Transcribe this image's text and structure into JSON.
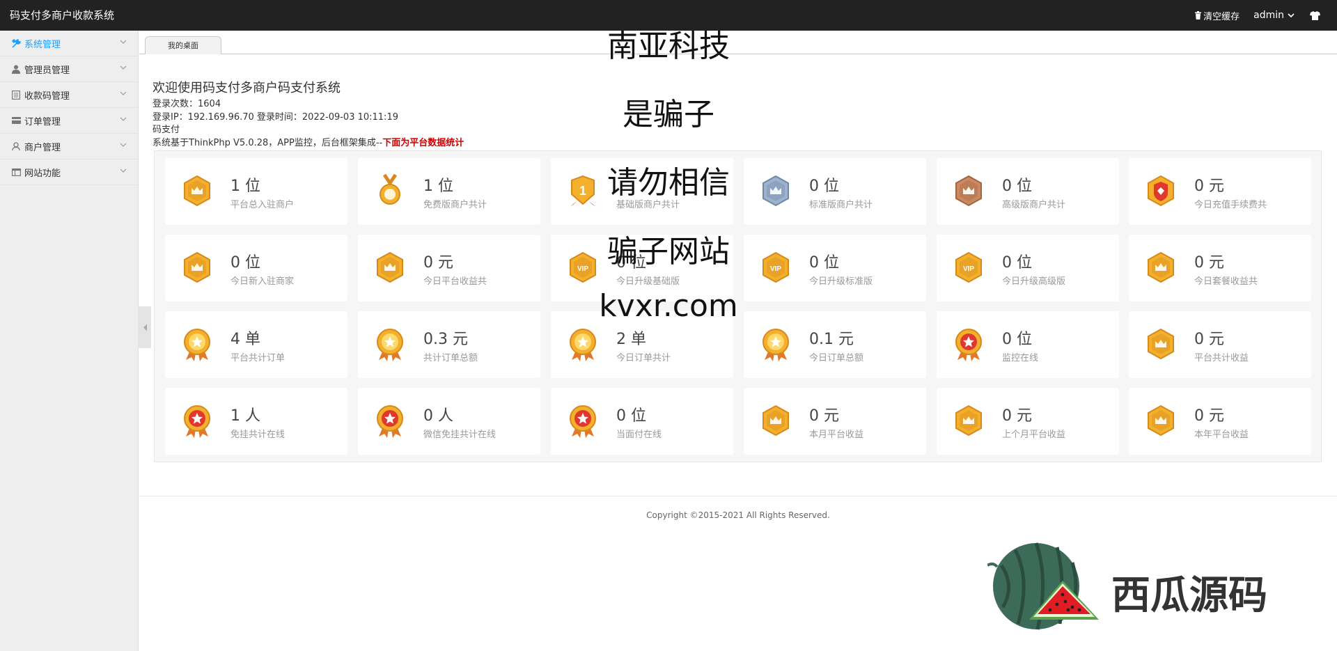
{
  "header": {
    "app_title": "码支付多商户收款系统",
    "clear_cache_label": "清空缓存",
    "user_label": "admin"
  },
  "sidebar": {
    "items": [
      {
        "label": "系统管理",
        "icon": "tools-icon"
      },
      {
        "label": "管理员管理",
        "icon": "user-icon"
      },
      {
        "label": "收款码管理",
        "icon": "document-icon"
      },
      {
        "label": "订单管理",
        "icon": "card-icon"
      },
      {
        "label": "商户管理",
        "icon": "merchant-icon"
      },
      {
        "label": "网站功能",
        "icon": "window-icon"
      }
    ]
  },
  "tabs": [
    {
      "label": "我的桌面"
    }
  ],
  "welcome": {
    "title": "欢迎使用码支付多商户码支付系统",
    "login_count": "登录次数：1604",
    "login_ip": "登录IP：192.169.96.70 登录时间：2022-09-03 10:11:19",
    "product": "码支付",
    "desc_prefix": "系统基于ThinkPhp V5.0.28，APP监控，后台框架集成--",
    "desc_highlight": "下面为平台数据统计"
  },
  "stats": [
    {
      "value": "1 位",
      "label": "平台总入驻商户",
      "medal": "crown-gold"
    },
    {
      "value": "1 位",
      "label": "免费版商户共计",
      "medal": "ribbon-gold"
    },
    {
      "value": "",
      "label": "基础版商户共计",
      "medal": "number-one"
    },
    {
      "value": "0 位",
      "label": "标准版商户共计",
      "medal": "crown-silver"
    },
    {
      "value": "0 位",
      "label": "高级版商户共计",
      "medal": "crown-bronze"
    },
    {
      "value": "0 元",
      "label": "今日充值手续费共",
      "medal": "red-shield"
    },
    {
      "value": "0 位",
      "label": "今日新入驻商家",
      "medal": "crown-gold"
    },
    {
      "value": "0 元",
      "label": "今日平台收益共",
      "medal": "crown-gold"
    },
    {
      "value": "0 位",
      "label": "今日升级基础版",
      "medal": "vip-gold"
    },
    {
      "value": "0 位",
      "label": "今日升级标准版",
      "medal": "vip-gold"
    },
    {
      "value": "0 位",
      "label": "今日升级高级版",
      "medal": "vip-gold"
    },
    {
      "value": "0 元",
      "label": "今日套餐收益共",
      "medal": "crown-gold"
    },
    {
      "value": "4 单",
      "label": "平台共计订单",
      "medal": "star-gold"
    },
    {
      "value": "0.3 元",
      "label": "共计订单总额",
      "medal": "star-gold"
    },
    {
      "value": "2 单",
      "label": "今日订单共计",
      "medal": "star-gold"
    },
    {
      "value": "0.1 元",
      "label": "今日订单总额",
      "medal": "star-gold"
    },
    {
      "value": "0 位",
      "label": "监控在线",
      "medal": "star-red"
    },
    {
      "value": "0 元",
      "label": "平台共计收益",
      "medal": "crown-gold"
    },
    {
      "value": "1 人",
      "label": "免挂共计在线",
      "medal": "star-red"
    },
    {
      "value": "0 人",
      "label": "微信免挂共计在线",
      "medal": "star-red"
    },
    {
      "value": "0 位",
      "label": "当面付在线",
      "medal": "star-red"
    },
    {
      "value": "0 元",
      "label": "本月平台收益",
      "medal": "crown-gold"
    },
    {
      "value": "0 元",
      "label": "上个月平台收益",
      "medal": "crown-gold"
    },
    {
      "value": "0 元",
      "label": "本年平台收益",
      "medal": "crown-gold"
    }
  ],
  "footer": {
    "copyright": "Copyright ©2015-2021 All Rights Reserved."
  },
  "overlay": {
    "lines": [
      "南亚科技",
      "是骗子",
      "请勿相信",
      "骗子网站",
      "kvxr.com"
    ]
  },
  "logo": {
    "text": "西瓜源码"
  },
  "colors": {
    "topbar": "#222222",
    "sidebar": "#eeeeee",
    "active": "#1e9fff",
    "highlight": "#cc0000",
    "gold": "#f0b429"
  }
}
